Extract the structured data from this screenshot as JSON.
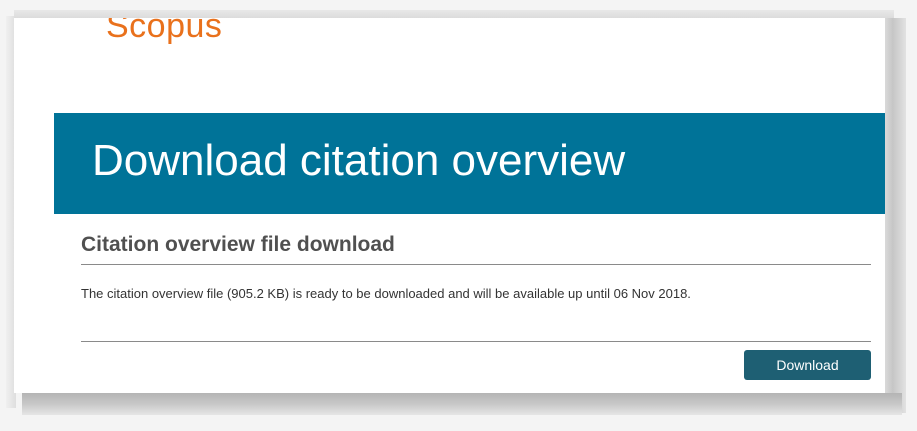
{
  "brand": {
    "logo_text": "Scopus",
    "logo_color": "#e9711c"
  },
  "hero": {
    "title": "Download citation overview",
    "background_color": "#007398"
  },
  "section": {
    "title": "Citation overview file download",
    "message": "The citation overview file (905.2 KB) is ready to be downloaded and will be available up until 06 Nov 2018."
  },
  "actions": {
    "download_label": "Download",
    "button_color": "#1e5f73"
  }
}
